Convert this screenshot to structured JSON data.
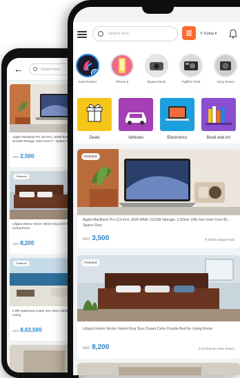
{
  "back_screen": {
    "search_placeholder": "Search here",
    "items": [
      {
        "title": "Apple MacBook Pro 16-inch, 16GB RAM, 512GB Storage, Intel Core i7 - Space Grey",
        "currency": "AED",
        "price": "2,500"
      },
      {
        "badge": "Featured",
        "title": "Lillyput Interio Vector Velvet King Size Bed for Living Room",
        "currency": "AED",
        "price": "8,200"
      },
      {
        "badge": "Featured",
        "title": "2 BR Apartment Lease Sea View Lifestyle Living",
        "currency": "AED",
        "price": "8,63,500"
      }
    ]
  },
  "front_screen": {
    "search_placeholder": "Search here",
    "location": "Dubai",
    "stories": [
      {
        "label": "Kala Product"
      },
      {
        "label": "iPhone 8"
      },
      {
        "label": "Bryant Deals"
      },
      {
        "label": "Fujifilm X100"
      },
      {
        "label": "Sony Stores"
      }
    ],
    "categories": [
      {
        "label": "Deals",
        "color": "#f5c518"
      },
      {
        "label": "Vehicles",
        "color": "#a43fb6"
      },
      {
        "label": "Electronics",
        "color": "#1a9fe0"
      },
      {
        "label": "Book and Art",
        "color": "#8a4fd0"
      }
    ],
    "listings": [
      {
        "badge": "Featured",
        "title": "Apple MacBook Pro (13-inch, 8GB RAM, 512GB Storage, 2.0GHz 10th Gen Intel Core i5) - Space Grey",
        "currency": "AED",
        "price": "3,500",
        "seller": "Sheikh Zayed Road"
      },
      {
        "badge": "Featured",
        "title": "Lillyput Interio Vector Velvet King Size Cream Color Double Bed for Living Room",
        "currency": "AED",
        "price": "8,200",
        "seller": "Al Kheeran Suite Towers"
      }
    ]
  }
}
